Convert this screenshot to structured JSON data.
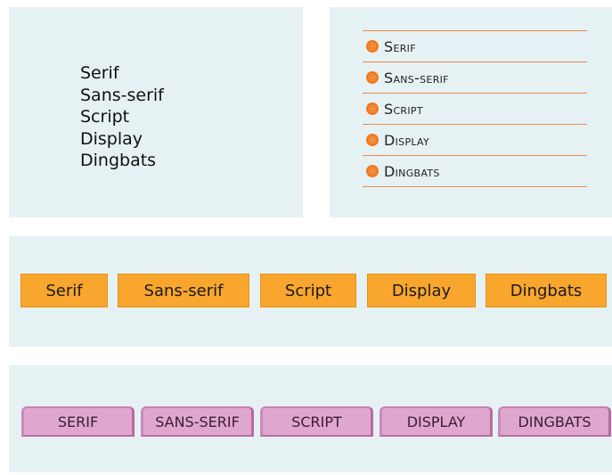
{
  "plain_list": {
    "items": [
      "Serif",
      "Sans-serif",
      "Script",
      "Display",
      "Dingbats"
    ]
  },
  "bullet_list": {
    "icon": "orange-flower-bullet-icon",
    "items": [
      "Serif",
      "Sans-serif",
      "Script",
      "Display",
      "Dingbats"
    ]
  },
  "orange_menu": {
    "items": [
      "Serif",
      "Sans-serif",
      "Script",
      "Display",
      "Dingbats"
    ]
  },
  "tab_menu": {
    "items": [
      "SERIF",
      "SANS-SERIF",
      "SCRIPT",
      "DISPLAY",
      "DINGBATS"
    ]
  },
  "colors": {
    "panel_background": "#e6f1f4",
    "accent_orange": "#f8a62d",
    "divider_orange": "#e98a47",
    "tab_pink": "#dfa7cf"
  }
}
